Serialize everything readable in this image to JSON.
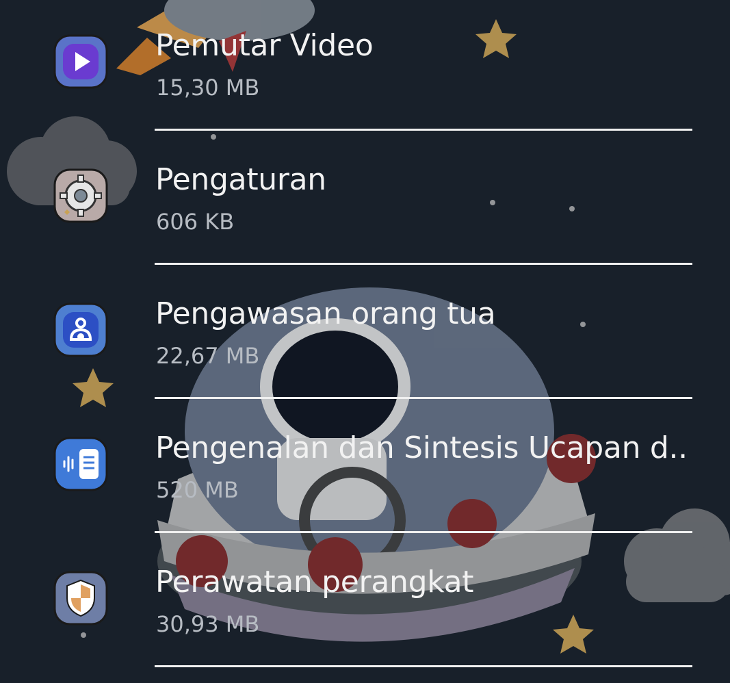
{
  "apps": [
    {
      "name": "Pemutar Video",
      "size": "15,30 MB",
      "icon": "video-player-icon"
    },
    {
      "name": "Pengaturan",
      "size": "606 KB",
      "icon": "settings-gear-icon"
    },
    {
      "name": "Pengawasan orang tua",
      "size": "22,67 MB",
      "icon": "parental-control-icon"
    },
    {
      "name": "Pengenalan dan Sintesis Ucapan d..",
      "size": "520 MB",
      "icon": "speech-recognition-icon"
    },
    {
      "name": "Perawatan perangkat",
      "size": "30,93 MB",
      "icon": "device-care-shield-icon"
    }
  ],
  "colors": {
    "background": "#18202a",
    "text_primary": "#f2f2f2",
    "text_secondary": "#b7bcc3",
    "divider": "#f0f0f0"
  }
}
